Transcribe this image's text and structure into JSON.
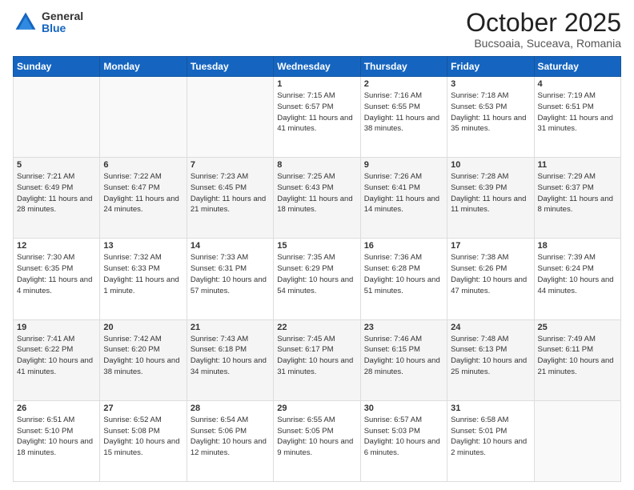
{
  "header": {
    "logo_general": "General",
    "logo_blue": "Blue",
    "month": "October 2025",
    "location": "Bucsoaia, Suceava, Romania"
  },
  "days_of_week": [
    "Sunday",
    "Monday",
    "Tuesday",
    "Wednesday",
    "Thursday",
    "Friday",
    "Saturday"
  ],
  "weeks": [
    [
      {
        "day": "",
        "info": ""
      },
      {
        "day": "",
        "info": ""
      },
      {
        "day": "",
        "info": ""
      },
      {
        "day": "1",
        "info": "Sunrise: 7:15 AM\nSunset: 6:57 PM\nDaylight: 11 hours and 41 minutes."
      },
      {
        "day": "2",
        "info": "Sunrise: 7:16 AM\nSunset: 6:55 PM\nDaylight: 11 hours and 38 minutes."
      },
      {
        "day": "3",
        "info": "Sunrise: 7:18 AM\nSunset: 6:53 PM\nDaylight: 11 hours and 35 minutes."
      },
      {
        "day": "4",
        "info": "Sunrise: 7:19 AM\nSunset: 6:51 PM\nDaylight: 11 hours and 31 minutes."
      }
    ],
    [
      {
        "day": "5",
        "info": "Sunrise: 7:21 AM\nSunset: 6:49 PM\nDaylight: 11 hours and 28 minutes."
      },
      {
        "day": "6",
        "info": "Sunrise: 7:22 AM\nSunset: 6:47 PM\nDaylight: 11 hours and 24 minutes."
      },
      {
        "day": "7",
        "info": "Sunrise: 7:23 AM\nSunset: 6:45 PM\nDaylight: 11 hours and 21 minutes."
      },
      {
        "day": "8",
        "info": "Sunrise: 7:25 AM\nSunset: 6:43 PM\nDaylight: 11 hours and 18 minutes."
      },
      {
        "day": "9",
        "info": "Sunrise: 7:26 AM\nSunset: 6:41 PM\nDaylight: 11 hours and 14 minutes."
      },
      {
        "day": "10",
        "info": "Sunrise: 7:28 AM\nSunset: 6:39 PM\nDaylight: 11 hours and 11 minutes."
      },
      {
        "day": "11",
        "info": "Sunrise: 7:29 AM\nSunset: 6:37 PM\nDaylight: 11 hours and 8 minutes."
      }
    ],
    [
      {
        "day": "12",
        "info": "Sunrise: 7:30 AM\nSunset: 6:35 PM\nDaylight: 11 hours and 4 minutes."
      },
      {
        "day": "13",
        "info": "Sunrise: 7:32 AM\nSunset: 6:33 PM\nDaylight: 11 hours and 1 minute."
      },
      {
        "day": "14",
        "info": "Sunrise: 7:33 AM\nSunset: 6:31 PM\nDaylight: 10 hours and 57 minutes."
      },
      {
        "day": "15",
        "info": "Sunrise: 7:35 AM\nSunset: 6:29 PM\nDaylight: 10 hours and 54 minutes."
      },
      {
        "day": "16",
        "info": "Sunrise: 7:36 AM\nSunset: 6:28 PM\nDaylight: 10 hours and 51 minutes."
      },
      {
        "day": "17",
        "info": "Sunrise: 7:38 AM\nSunset: 6:26 PM\nDaylight: 10 hours and 47 minutes."
      },
      {
        "day": "18",
        "info": "Sunrise: 7:39 AM\nSunset: 6:24 PM\nDaylight: 10 hours and 44 minutes."
      }
    ],
    [
      {
        "day": "19",
        "info": "Sunrise: 7:41 AM\nSunset: 6:22 PM\nDaylight: 10 hours and 41 minutes."
      },
      {
        "day": "20",
        "info": "Sunrise: 7:42 AM\nSunset: 6:20 PM\nDaylight: 10 hours and 38 minutes."
      },
      {
        "day": "21",
        "info": "Sunrise: 7:43 AM\nSunset: 6:18 PM\nDaylight: 10 hours and 34 minutes."
      },
      {
        "day": "22",
        "info": "Sunrise: 7:45 AM\nSunset: 6:17 PM\nDaylight: 10 hours and 31 minutes."
      },
      {
        "day": "23",
        "info": "Sunrise: 7:46 AM\nSunset: 6:15 PM\nDaylight: 10 hours and 28 minutes."
      },
      {
        "day": "24",
        "info": "Sunrise: 7:48 AM\nSunset: 6:13 PM\nDaylight: 10 hours and 25 minutes."
      },
      {
        "day": "25",
        "info": "Sunrise: 7:49 AM\nSunset: 6:11 PM\nDaylight: 10 hours and 21 minutes."
      }
    ],
    [
      {
        "day": "26",
        "info": "Sunrise: 6:51 AM\nSunset: 5:10 PM\nDaylight: 10 hours and 18 minutes."
      },
      {
        "day": "27",
        "info": "Sunrise: 6:52 AM\nSunset: 5:08 PM\nDaylight: 10 hours and 15 minutes."
      },
      {
        "day": "28",
        "info": "Sunrise: 6:54 AM\nSunset: 5:06 PM\nDaylight: 10 hours and 12 minutes."
      },
      {
        "day": "29",
        "info": "Sunrise: 6:55 AM\nSunset: 5:05 PM\nDaylight: 10 hours and 9 minutes."
      },
      {
        "day": "30",
        "info": "Sunrise: 6:57 AM\nSunset: 5:03 PM\nDaylight: 10 hours and 6 minutes."
      },
      {
        "day": "31",
        "info": "Sunrise: 6:58 AM\nSunset: 5:01 PM\nDaylight: 10 hours and 2 minutes."
      },
      {
        "day": "",
        "info": ""
      }
    ]
  ]
}
